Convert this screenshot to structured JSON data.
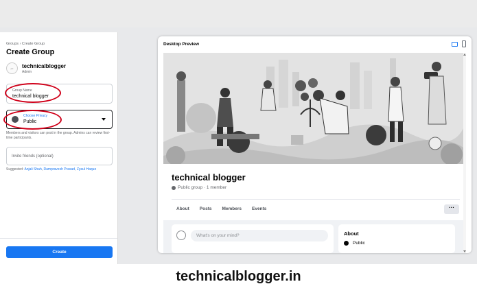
{
  "sidebar": {
    "breadcrumb": "Groups › Create Group",
    "title": "Create Group",
    "admin": {
      "avatar_text": "pic",
      "name": "technicalblogger",
      "role": "Admin"
    },
    "group_name": {
      "label": "Group Name",
      "value": "technical blogger"
    },
    "privacy": {
      "label": "Choose Privacy",
      "value": "Public",
      "help": "Members and visitors can post in the group. Admins can review first-time participants."
    },
    "invite": {
      "placeholder": "Invite friends (optional)"
    },
    "suggested": {
      "prefix": "Suggested:",
      "names": [
        "Anjali Shah",
        "Rampravesh Prasad",
        "Zyaul Haque"
      ]
    },
    "create_label": "Create"
  },
  "preview": {
    "title": "Desktop Preview",
    "group_name": "technical blogger",
    "meta": "Public group · 1 member",
    "tabs": [
      "About",
      "Posts",
      "Members",
      "Events"
    ],
    "more_label": "···",
    "post_placeholder": "What's on your mind?",
    "about": {
      "title": "About",
      "privacy": "Public"
    }
  },
  "watermark": "technicalblogger.in",
  "colors": {
    "accent": "#1877f2",
    "highlight": "#d0021b"
  }
}
